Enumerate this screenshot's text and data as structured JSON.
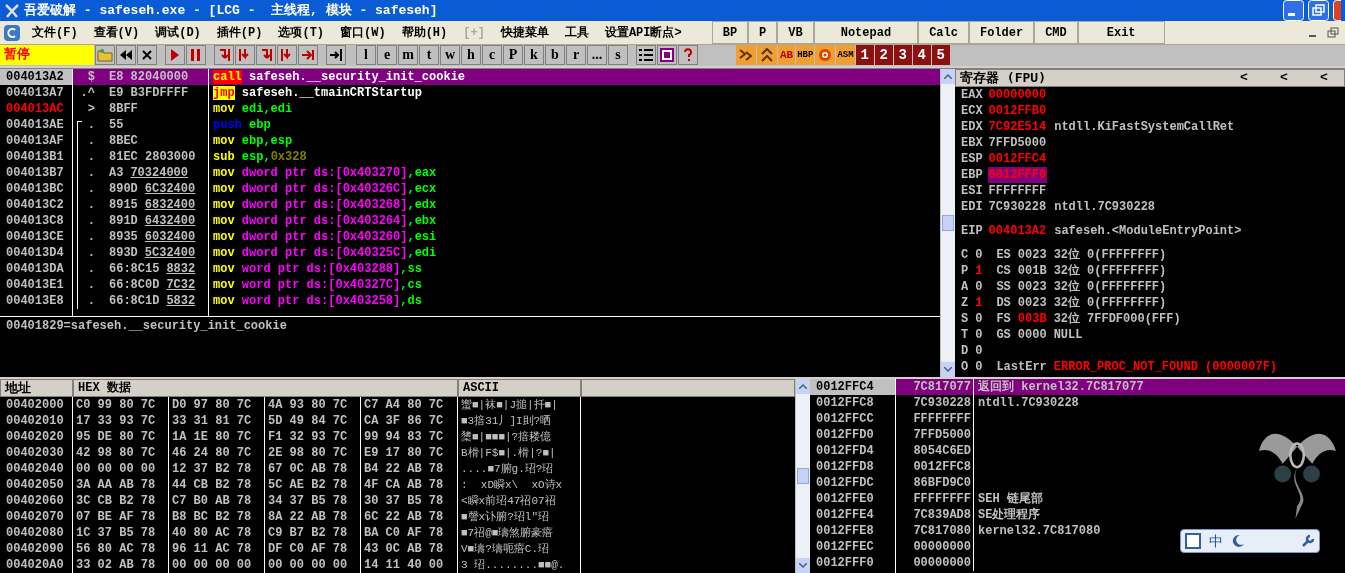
{
  "window": {
    "title": "吾爱破解 - safeseh.exe - [LCG -  主线程, 模块 - safeseh]"
  },
  "menu": [
    {
      "label": "文件(F)",
      "disabled": false
    },
    {
      "label": "查看(V)",
      "disabled": false
    },
    {
      "label": "调试(D)",
      "disabled": false
    },
    {
      "label": "插件(P)",
      "disabled": false
    },
    {
      "label": "选项(T)",
      "disabled": false
    },
    {
      "label": "窗口(W)",
      "disabled": false
    },
    {
      "label": "帮助(H)",
      "disabled": false
    },
    {
      "label": "[+]",
      "disabled": true
    },
    {
      "label": "快捷菜单",
      "disabled": false
    },
    {
      "label": "工具",
      "disabled": false
    },
    {
      "label": "设置API断点>",
      "disabled": false
    }
  ],
  "quick_buttons": [
    "BP",
    "P",
    "VB",
    "Notepad",
    "Calc",
    "Folder",
    "CMD",
    "Exit"
  ],
  "toolbar": {
    "status": "暂停",
    "letters": [
      "l",
      "e",
      "m",
      "t",
      "w",
      "h",
      "c",
      "P",
      "k",
      "b",
      "r",
      "...",
      "s"
    ],
    "plugin_labels": [
      "AB",
      "HBP",
      "ASM"
    ],
    "numbers": [
      "1",
      "2",
      "3",
      "4",
      "5"
    ]
  },
  "disassembly": {
    "rows": [
      {
        "address": "004013A2",
        "selected": true,
        "jump_target": false,
        "in_bracket": false,
        "marker": "$",
        "opcode": "E8 82040000",
        "instruction": [
          {
            "text": "call",
            "kind": "call"
          },
          {
            "text": " safeseh.__security_init_cookie",
            "kind": "sym"
          }
        ]
      },
      {
        "address": "004013A7",
        "selected": false,
        "jump_target": false,
        "in_bracket": false,
        "marker": ".^",
        "opcode": "E9 B3FDFFFF",
        "instruction": [
          {
            "text": "jmp",
            "kind": "jmp"
          },
          {
            "text": " safeseh.__tmainCRTStartup",
            "kind": "sym"
          }
        ]
      },
      {
        "address": "004013AC",
        "selected": false,
        "jump_target": true,
        "in_bracket": false,
        "marker": ">",
        "opcode": "8BFF",
        "instruction": [
          {
            "text": "mov",
            "kind": "op"
          },
          {
            "text": " edi,edi",
            "kind": "reg"
          }
        ]
      },
      {
        "address": "004013AE",
        "selected": false,
        "jump_target": false,
        "in_bracket": true,
        "marker": ".",
        "opcode": "55",
        "instruction": [
          {
            "text": "push",
            "kind": "push"
          },
          {
            "text": " ebp",
            "kind": "reg"
          }
        ]
      },
      {
        "address": "004013AF",
        "selected": false,
        "jump_target": false,
        "in_bracket": true,
        "marker": ".",
        "opcode": "8BEC",
        "instruction": [
          {
            "text": "mov",
            "kind": "op"
          },
          {
            "text": " ebp,esp",
            "kind": "reg"
          }
        ]
      },
      {
        "address": "004013B1",
        "selected": false,
        "jump_target": false,
        "in_bracket": true,
        "marker": ".",
        "opcode": "81EC 2803000",
        "instruction": [
          {
            "text": "sub",
            "kind": "op"
          },
          {
            "text": " esp,",
            "kind": "reg"
          },
          {
            "text": "0x328",
            "kind": "const"
          }
        ]
      },
      {
        "address": "004013B7",
        "selected": false,
        "jump_target": false,
        "in_bracket": true,
        "marker": ".",
        "opcode": "A3",
        "operand": "70324000",
        "instruction": [
          {
            "text": "mov",
            "kind": "op"
          },
          {
            "text": " dword ptr ds:[0x403270]",
            "kind": "mem"
          },
          {
            "text": ",eax",
            "kind": "reg"
          }
        ]
      },
      {
        "address": "004013BC",
        "selected": false,
        "jump_target": false,
        "in_bracket": true,
        "marker": ".",
        "opcode": "890D",
        "operand": "6C32400",
        "instruction": [
          {
            "text": "mov",
            "kind": "op"
          },
          {
            "text": " dword ptr ds:[0x40326C]",
            "kind": "mem"
          },
          {
            "text": ",ecx",
            "kind": "reg"
          }
        ]
      },
      {
        "address": "004013C2",
        "selected": false,
        "jump_target": false,
        "in_bracket": true,
        "marker": ".",
        "opcode": "8915",
        "operand": "6832400",
        "instruction": [
          {
            "text": "mov",
            "kind": "op"
          },
          {
            "text": " dword ptr ds:[0x403268]",
            "kind": "mem"
          },
          {
            "text": ",edx",
            "kind": "reg"
          }
        ]
      },
      {
        "address": "004013C8",
        "selected": false,
        "jump_target": false,
        "in_bracket": true,
        "marker": ".",
        "opcode": "891D",
        "operand": "6432400",
        "instruction": [
          {
            "text": "mov",
            "kind": "op"
          },
          {
            "text": " dword ptr ds:[0x403264]",
            "kind": "mem"
          },
          {
            "text": ",ebx",
            "kind": "reg"
          }
        ]
      },
      {
        "address": "004013CE",
        "selected": false,
        "jump_target": false,
        "in_bracket": true,
        "marker": ".",
        "opcode": "8935",
        "operand": "6032400",
        "instruction": [
          {
            "text": "mov",
            "kind": "op"
          },
          {
            "text": " dword ptr ds:[0x403260]",
            "kind": "mem"
          },
          {
            "text": ",esi",
            "kind": "reg"
          }
        ]
      },
      {
        "address": "004013D4",
        "selected": false,
        "jump_target": false,
        "in_bracket": true,
        "marker": ".",
        "opcode": "893D",
        "operand": "5C32400",
        "instruction": [
          {
            "text": "mov",
            "kind": "op"
          },
          {
            "text": " dword ptr ds:[0x40325C]",
            "kind": "mem"
          },
          {
            "text": ",edi",
            "kind": "reg"
          }
        ]
      },
      {
        "address": "004013DA",
        "selected": false,
        "jump_target": false,
        "in_bracket": true,
        "marker": ".",
        "opcode": "66:8C15",
        "operand": "8832",
        "instruction": [
          {
            "text": "mov",
            "kind": "op"
          },
          {
            "text": " word ptr ds:[0x403288]",
            "kind": "mem"
          },
          {
            "text": ",ss",
            "kind": "reg"
          }
        ]
      },
      {
        "address": "004013E1",
        "selected": false,
        "jump_target": false,
        "in_bracket": true,
        "marker": ".",
        "opcode": "66:8C0D",
        "operand": "7C32",
        "instruction": [
          {
            "text": "mov",
            "kind": "op"
          },
          {
            "text": " word ptr ds:[0x40327C]",
            "kind": "mem"
          },
          {
            "text": ",cs",
            "kind": "reg"
          }
        ]
      },
      {
        "address": "004013E8",
        "selected": false,
        "jump_target": false,
        "in_bracket": true,
        "marker": ".",
        "opcode": "66:8C1D",
        "operand": "5832",
        "instruction": [
          {
            "text": "mov",
            "kind": "op"
          },
          {
            "text": " word ptr ds:[0x403258]",
            "kind": "mem"
          },
          {
            "text": ",ds",
            "kind": "reg"
          }
        ]
      }
    ],
    "info": "00401829=safeseh.__security_init_cookie"
  },
  "registers": {
    "title": "寄存器 (FPU)",
    "nav": [
      "<",
      "<",
      "<"
    ],
    "groups": [
      {
        "registers": [
          {
            "name": "EAX",
            "value": "00000000",
            "changed": true,
            "highlighted": false
          },
          {
            "name": "ECX",
            "value": "0012FFB0",
            "changed": true,
            "highlighted": false
          },
          {
            "name": "EDX",
            "value": "7C92E514",
            "changed": true,
            "highlighted": false,
            "comment": "ntdll.KiFastSystemCallRet"
          },
          {
            "name": "EBX",
            "value": "7FFD5000",
            "changed": false,
            "highlighted": false
          },
          {
            "name": "ESP",
            "value": "0012FFC4",
            "changed": true,
            "highlighted": false
          },
          {
            "name": "EBP",
            "value": "0012FFF0",
            "changed": true,
            "highlighted": true
          },
          {
            "name": "ESI",
            "value": "FFFFFFFF",
            "changed": false,
            "highlighted": false
          },
          {
            "name": "EDI",
            "value": "7C930228",
            "changed": false,
            "highlighted": false,
            "comment": "ntdll.7C930228"
          }
        ]
      },
      {
        "registers": [
          {
            "name": "EIP",
            "value": "004013A2",
            "changed": true,
            "highlighted": false,
            "comment": "safeseh.<ModuleEntryPoint>"
          }
        ]
      }
    ],
    "flags": [
      {
        "flag": "C",
        "value": "0",
        "changed": false,
        "segment": {
          "name": "ES",
          "value": "0023",
          "changed": false,
          "bits": "32位",
          "base": "0(FFFFFFFF)"
        }
      },
      {
        "flag": "P",
        "value": "1",
        "changed": true,
        "segment": {
          "name": "CS",
          "value": "001B",
          "changed": false,
          "bits": "32位",
          "base": "0(FFFFFFFF)"
        }
      },
      {
        "flag": "A",
        "value": "0",
        "changed": false,
        "segment": {
          "name": "SS",
          "value": "0023",
          "changed": false,
          "bits": "32位",
          "base": "0(FFFFFFFF)"
        }
      },
      {
        "flag": "Z",
        "value": "1",
        "changed": true,
        "segment": {
          "name": "DS",
          "value": "0023",
          "changed": false,
          "bits": "32位",
          "base": "0(FFFFFFFF)"
        }
      },
      {
        "flag": "S",
        "value": "0",
        "changed": false,
        "segment": {
          "name": "FS",
          "value": "003B",
          "changed": true,
          "bits": "32位",
          "base": "7FFDF000(FFF)"
        }
      },
      {
        "flag": "T",
        "value": "0",
        "changed": false,
        "segment": {
          "name": "GS",
          "value": "0000",
          "changed": false,
          "base": "NULL"
        }
      },
      {
        "flag": "D",
        "value": "0",
        "changed": false
      },
      {
        "flag": "O",
        "value": "0",
        "changed": false,
        "last_error": {
          "label": "LastErr",
          "value": "ERROR_PROC_NOT_FOUND (0000007F)"
        }
      }
    ]
  },
  "dump": {
    "columns": [
      "地址",
      "HEX 数据",
      "ASCII"
    ],
    "rows": [
      {
        "address": "00402000",
        "hex": [
          "C0 99 80 7C",
          "D0 97 80 7C",
          "4A 93 80 7C",
          "C7 A4 80 7C"
        ],
        "ascii": "蠁■|袜■|J搥|扦■|"
      },
      {
        "address": "00402010",
        "hex": [
          "17 33 93 7C",
          "33 31 81 7C",
          "5D 49 84 7C",
          "CA 3F 86 7C"
        ],
        "ascii": "■3揞31丿]I刞?哂"
      },
      {
        "address": "00402020",
        "hex": [
          "95 DE 80 7C",
          "1A 1E 80 7C",
          "F1 32 93 7C",
          "99 94 83 7C"
        ],
        "ascii": "橥■|■■■|?揞耧億"
      },
      {
        "address": "00402030",
        "hex": [
          "42 98 80 7C",
          "46 24 80 7C",
          "2E 98 80 7C",
          "E9 17 80 7C"
        ],
        "ascii": "B榾|F$■|.榾|?■|"
      },
      {
        "address": "00402040",
        "hex": [
          "00 00 00 00",
          "12 37 B2 78",
          "67 0C AB 78",
          "B4 22 AB 78"
        ],
        "ascii": "....■7腑g.玿?玿"
      },
      {
        "address": "00402050",
        "hex": [
          "3A AA AB 78",
          "44 CB B2 78",
          "5C AE B2 78",
          "4F CA AB 78"
        ],
        "ascii": ":  xD瞬x\\  xO诗x"
      },
      {
        "address": "00402060",
        "hex": [
          "3C CB B2 78",
          "C7 B0 AB 78",
          "34 37 B5 78",
          "30 37 B5 78"
        ],
        "ascii": "<瞬x前玿47祒07祒"
      },
      {
        "address": "00402070",
        "hex": [
          "07 BE AF 78",
          "B8 BC B2 78",
          "8A 22 AB 78",
          "6C 22 AB 78"
        ],
        "ascii": "■謦x讣腑?玿l\"玿"
      },
      {
        "address": "00402080",
        "hex": [
          "1C 37 B5 78",
          "40 80 AC 78",
          "C9 B7 B2 78",
          "BA C0 AF 78"
        ],
        "ascii": "■7祒@■璹煞腑豪瘖"
      },
      {
        "address": "00402090",
        "hex": [
          "56 80 AC 78",
          "96 11 AC 78",
          "DF C0 AF 78",
          "43 0C AB 78"
        ],
        "ascii": "V■璹?璹呃瘖C.玿"
      },
      {
        "address": "004020A0",
        "hex": [
          "33 02 AB 78",
          "00 00 00 00",
          "00 00 00 00",
          "14 11 40 00"
        ],
        "ascii": "3 玿........■■@."
      }
    ]
  },
  "stack": {
    "rows": [
      {
        "address": "0012FFC4",
        "value": "7C817077",
        "selected": true,
        "comment": "返回到 kernel32.7C817077"
      },
      {
        "address": "0012FFC8",
        "value": "7C930228",
        "selected": false,
        "comment": "ntdll.7C930228"
      },
      {
        "address": "0012FFCC",
        "value": "FFFFFFFF",
        "selected": false
      },
      {
        "address": "0012FFD0",
        "value": "7FFD5000",
        "selected": false
      },
      {
        "address": "0012FFD4",
        "value": "8054C6ED",
        "selected": false
      },
      {
        "address": "0012FFD8",
        "value": "0012FFC8",
        "selected": false
      },
      {
        "address": "0012FFDC",
        "value": "86BFD9C0",
        "selected": false
      },
      {
        "address": "0012FFE0",
        "value": "FFFFFFFF",
        "selected": false,
        "comment": "SEH 链尾部"
      },
      {
        "address": "0012FFE4",
        "value": "7C839AD8",
        "selected": false,
        "comment": "SE处理程序"
      },
      {
        "address": "0012FFE8",
        "value": "7C817080",
        "selected": false,
        "comment": "kernel32.7C817080"
      },
      {
        "address": "0012FFEC",
        "value": "00000000",
        "selected": false
      },
      {
        "address": "0012FFF0",
        "value": "00000000",
        "selected": false
      }
    ]
  },
  "ime_bar": {
    "mode": "中"
  }
}
